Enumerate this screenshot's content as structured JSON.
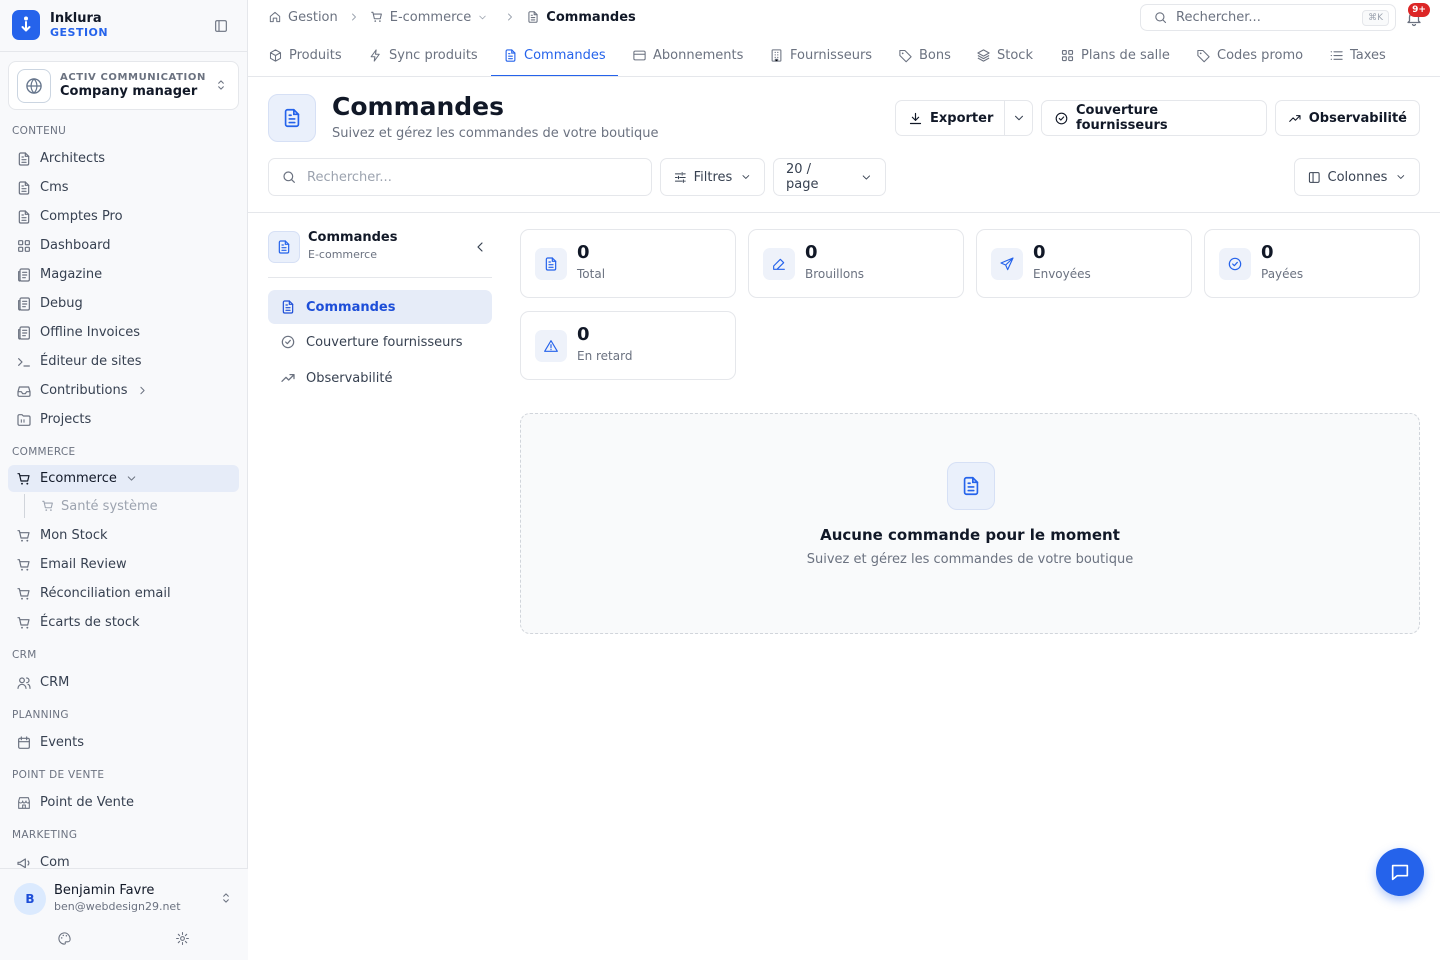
{
  "app": {
    "name": "Inklura",
    "subtitle": "GESTION"
  },
  "org": {
    "subtitle": "ACTIV COMMUNICATION",
    "name": "Company manager"
  },
  "sidebar": {
    "sections": {
      "contenu": "CONTENU",
      "commerce": "COMMERCE",
      "crm": "CRM",
      "planning": "PLANNING",
      "pos": "POINT DE VENTE",
      "marketing": "MARKETING"
    },
    "items": [
      {
        "label": "Architects",
        "icon": "file-icon"
      },
      {
        "label": "Cms",
        "icon": "file-icon"
      },
      {
        "label": "Comptes Pro",
        "icon": "file-icon"
      },
      {
        "label": "Dashboard",
        "icon": "grid-icon"
      },
      {
        "label": "Magazine",
        "icon": "newspaper-icon"
      },
      {
        "label": "Debug",
        "icon": "newspaper-icon"
      },
      {
        "label": "Offline Invoices",
        "icon": "newspaper-icon"
      },
      {
        "label": "Éditeur de sites",
        "icon": "terminal-icon"
      },
      {
        "label": "Contributions",
        "icon": "inbox-icon"
      },
      {
        "label": "Projects",
        "icon": "folder-icon"
      },
      {
        "label": "Ecommerce",
        "icon": "cart-icon"
      },
      {
        "label": "Santé système",
        "icon": "cart-icon"
      },
      {
        "label": "Mon Stock",
        "icon": "cart-icon"
      },
      {
        "label": "Email Review",
        "icon": "cart-icon"
      },
      {
        "label": "Réconciliation email",
        "icon": "cart-icon"
      },
      {
        "label": "Écarts de stock",
        "icon": "cart-icon"
      },
      {
        "label": "CRM",
        "icon": "users-icon"
      },
      {
        "label": "Events",
        "icon": "calendar-icon"
      },
      {
        "label": "Point de Vente",
        "icon": "store-icon"
      },
      {
        "label": "Com",
        "icon": "megaphone-icon"
      }
    ]
  },
  "user": {
    "initial": "B",
    "name": "Benjamin Favre",
    "email": "ben@webdesign29.net"
  },
  "breadcrumb": {
    "home": "Gestion",
    "section": "E-commerce",
    "current": "Commandes"
  },
  "top_search": {
    "placeholder": "Rechercher...",
    "shortcut": "⌘K"
  },
  "notifications": {
    "badge": "9+"
  },
  "tabs": [
    {
      "label": "Produits",
      "icon": "box-icon"
    },
    {
      "label": "Sync produits",
      "icon": "bolt-icon"
    },
    {
      "label": "Commandes",
      "icon": "file-icon",
      "active": true
    },
    {
      "label": "Abonnements",
      "icon": "card-icon"
    },
    {
      "label": "Fournisseurs",
      "icon": "building-icon"
    },
    {
      "label": "Bons",
      "icon": "tag-icon"
    },
    {
      "label": "Stock",
      "icon": "layers-icon"
    },
    {
      "label": "Plans de salle",
      "icon": "grid-icon"
    },
    {
      "label": "Codes promo",
      "icon": "tag-icon"
    },
    {
      "label": "Taxes",
      "icon": "list-icon"
    }
  ],
  "page": {
    "title": "Commandes",
    "subtitle": "Suivez et gérez les commandes de votre boutique",
    "actions": {
      "export": "Exporter",
      "couverture": "Couverture fournisseurs",
      "observabilite": "Observabilité"
    }
  },
  "toolbar": {
    "search_placeholder": "Rechercher...",
    "filters": "Filtres",
    "per_page": "20 / page",
    "columns": "Colonnes"
  },
  "subnav": {
    "title": "Commandes",
    "subtitle": "E-commerce",
    "items": [
      "Commandes",
      "Couverture fournisseurs",
      "Observabilité"
    ]
  },
  "stats": [
    {
      "value": "0",
      "label": "Total",
      "icon": "file-icon"
    },
    {
      "value": "0",
      "label": "Brouillons",
      "icon": "pencil-icon"
    },
    {
      "value": "0",
      "label": "Envoyées",
      "icon": "send-icon"
    },
    {
      "value": "0",
      "label": "Payées",
      "icon": "check-circle-icon"
    },
    {
      "value": "0",
      "label": "En retard",
      "icon": "alert-icon"
    }
  ],
  "empty": {
    "title": "Aucune commande pour le moment",
    "subtitle": "Suivez et gérez les commandes de votre boutique"
  },
  "colors": {
    "accent": "#2563eb",
    "badge": "#dc2626"
  }
}
